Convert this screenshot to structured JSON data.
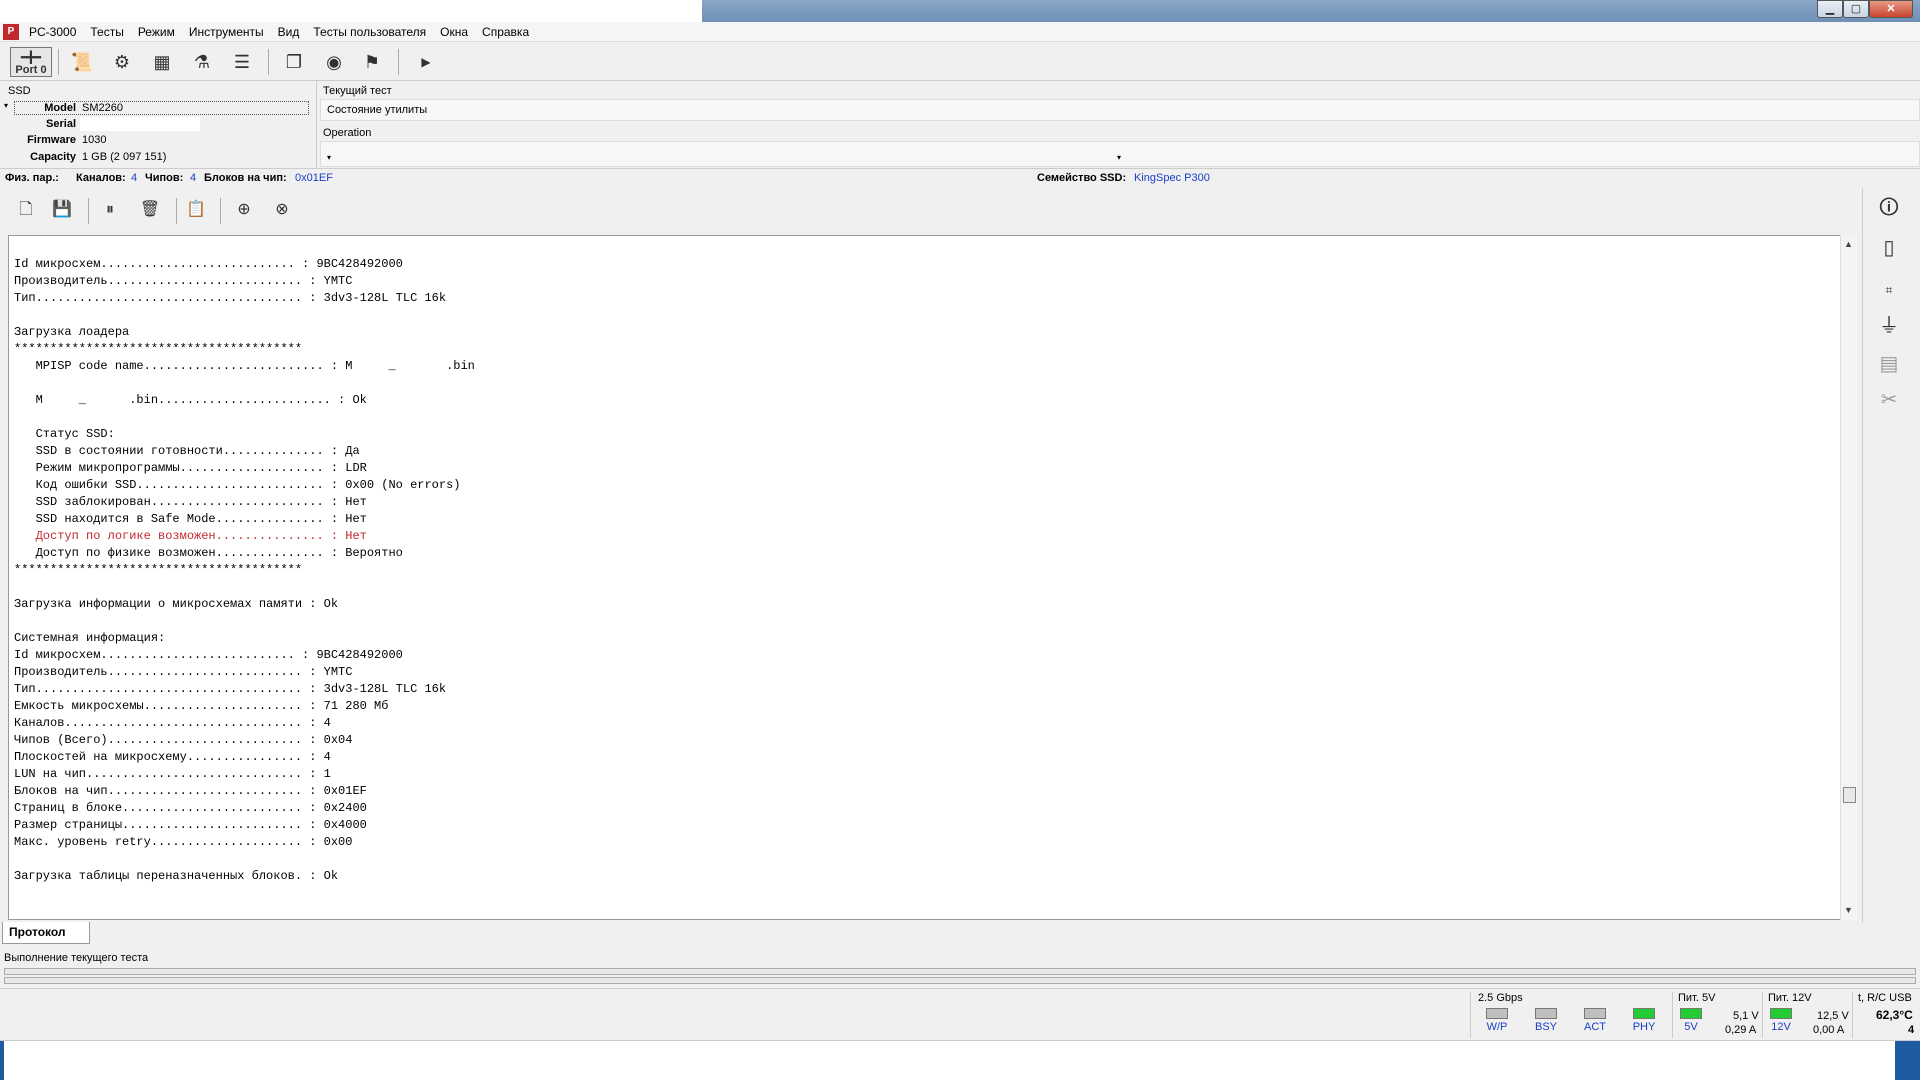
{
  "window": {
    "title": "PC-3000",
    "icon": "pc3000-icon"
  },
  "menu": [
    "Тесты",
    "Режим",
    "Инструменты",
    "Вид",
    "Тесты пользователя",
    "Окна",
    "Справка"
  ],
  "toolbar": {
    "port_label_line1": "━╋━",
    "port_label_line2": "Port 0"
  },
  "info": {
    "group": "SSD",
    "model_label": "Model",
    "model": "SM2260",
    "serial_label": "Serial",
    "serial": "",
    "firmware_label": "Firmware",
    "firmware": "1030",
    "capacity_label": "Capacity",
    "capacity": "1 GB (2 097 151)",
    "current_test_label": "Текущий тест",
    "current_test": "Состояние утилиты",
    "operation_label": "Operation"
  },
  "phys": {
    "label": "Физ. пар.:",
    "channels_label": "Каналов:",
    "channels": "4",
    "chips_label": "Чипов:",
    "chips": "4",
    "blocks_label": "Блоков на чип:",
    "blocks": "0x01EF",
    "family_label": "Семейство SSD:",
    "family": "KingSpec P300"
  },
  "log": {
    "lines": [
      "Id микросхем........................... : 9BC428492000",
      "Производитель........................... : YMTC",
      "Тип..................................... : 3dv3-128L TLC 16k",
      "",
      "Загрузка лоадера",
      "****************************************",
      "   MPISP code name......................... : M     _       .bin",
      "",
      "   M     _      .bin........................ : Ok",
      "",
      "   Статус SSD:",
      "   SSD в состоянии готовности.............. : Да",
      "   Режим микропрограммы.................... : LDR",
      "   Код ошибки SSD.......................... : 0x00 (No errors)",
      "   SSD заблокирован........................ : Нет",
      "   SSD находится в Safe Mode............... : Нет",
      "   Доступ по логике возможен............... : Нет",
      "   Доступ по физике возможен............... : Вероятно",
      "****************************************",
      "",
      "Загрузка информации о микросхемах памяти : Ok",
      "",
      "Системная информация:",
      "Id микросхем........................... : 9BC428492000",
      "Производитель........................... : YMTC",
      "Тип..................................... : 3dv3-128L TLC 16k",
      "Емкость микросхемы...................... : 71 280 Мб",
      "Каналов................................. : 4",
      "Чипов (Всего)........................... : 0x04",
      "Плоскостей на микросхему................ : 4",
      "LUN на чип.............................. : 1",
      "Блоков на чип........................... : 0x01EF",
      "Страниц в блоке......................... : 0x2400",
      "Размер страницы......................... : 0x4000",
      "Макс. уровень retry..................... : 0x00",
      "",
      "Загрузка таблицы переназначенных блоков. : Ok"
    ],
    "red_line_index": 16
  },
  "bottom": {
    "tab": "Протокол",
    "current_test_text": "Выполнение текущего теста"
  },
  "status": {
    "speed": "2.5 Gbps",
    "leds": [
      {
        "label": "W/P",
        "color": "#c0c0c0"
      },
      {
        "label": "BSY",
        "color": "#c0c0c0"
      },
      {
        "label": "ACT",
        "color": "#c0c0c0"
      },
      {
        "label": "PHY",
        "color": "#22cc33"
      }
    ],
    "p5_label": "Пит. 5V",
    "p5_led": "5V",
    "p5_volt": "5,1 V",
    "p5_amp": "0,29 A",
    "p12_label": "Пит. 12V",
    "p12_led": "12V",
    "p12_volt": "12,5 V",
    "p12_amp": "0,00 A",
    "temp_label": "t, R/C USB",
    "temp": "62,3°C",
    "rc": "4"
  }
}
